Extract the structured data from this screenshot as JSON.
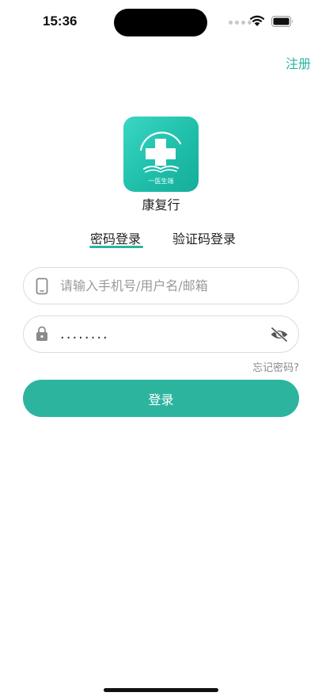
{
  "status_bar": {
    "time": "15:36"
  },
  "header": {
    "register_label": "注册"
  },
  "app": {
    "name": "康复行",
    "logo_caption": "一医生端",
    "brand_color": "#2cb4a0"
  },
  "tabs": [
    {
      "label": "密码登录",
      "active": true
    },
    {
      "label": "验证码登录",
      "active": false
    }
  ],
  "form": {
    "account": {
      "placeholder": "请输入手机号/用户名/邮箱",
      "value": "",
      "icon": "phone-icon"
    },
    "password": {
      "value": "........",
      "icon": "lock-icon",
      "toggle_icon": "eye-off-icon"
    },
    "forgot_label": "忘记密码?",
    "login_label": "登录"
  }
}
